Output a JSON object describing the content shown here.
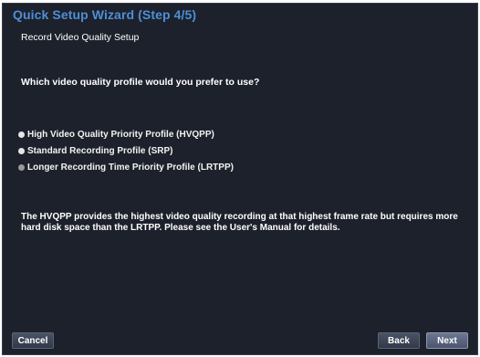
{
  "wizard": {
    "title": "Quick Setup Wizard (Step 4/5)",
    "subtitle": "Record Video Quality Setup",
    "question": "Which video quality profile would you prefer to use?",
    "options": [
      {
        "label": "High Video Quality Priority Profile (HVQPP)",
        "selected": false
      },
      {
        "label": "Standard Recording Profile (SRP)",
        "selected": false
      },
      {
        "label": "Longer Recording Time Priority Profile (LRTPP)",
        "selected": false
      }
    ],
    "description": "The HVQPP provides the highest video quality recording at that highest frame rate but requires more hard disk space than the LRTPP. Please see the User's Manual for details."
  },
  "buttons": {
    "cancel": "Cancel",
    "back": "Back",
    "next": "Next"
  },
  "colors": {
    "background": "#1d212b",
    "title": "#4d8fd6",
    "text": "#ffffff"
  }
}
